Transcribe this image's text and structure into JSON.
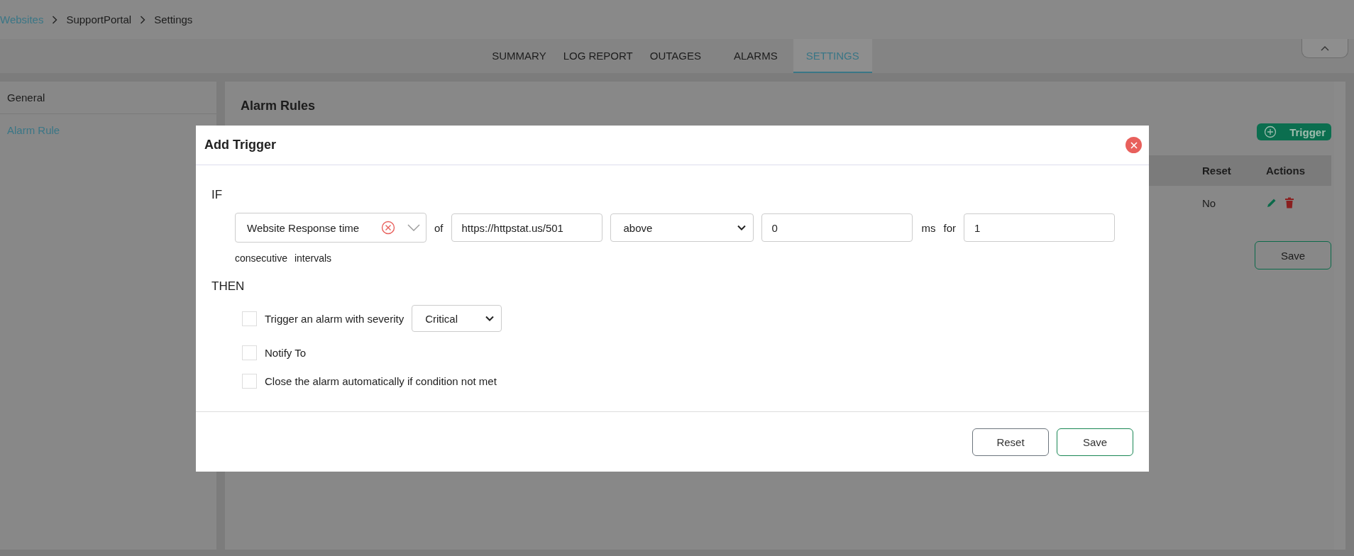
{
  "breadcrumb": [
    {
      "label": "Websites",
      "link": true
    },
    {
      "label": "SupportPortal",
      "link": false
    },
    {
      "label": "Settings",
      "link": false
    }
  ],
  "tabs": [
    {
      "label": "SUMMARY",
      "selected": false
    },
    {
      "label": "LOG REPORT",
      "selected": false
    },
    {
      "label": "OUTAGES",
      "selected": false
    },
    {
      "label": "ALARMS",
      "selected": false
    },
    {
      "label": "SETTINGS",
      "selected": true
    }
  ],
  "sidebar": {
    "items": [
      {
        "label": "General",
        "selected": false
      },
      {
        "label": "Alarm Rule",
        "selected": true
      }
    ]
  },
  "panel": {
    "title": "Alarm Rules",
    "add_button": "Trigger",
    "table": {
      "columns": [
        "Reset",
        "Actions"
      ],
      "rows": [
        {
          "reset": "No"
        }
      ]
    },
    "save_button": "Save"
  },
  "dialog": {
    "title": "Add Trigger",
    "if_label": "IF",
    "metric": "Website Response time",
    "of_label": "of",
    "url": "https://httpstat.us/501",
    "comparison": "above",
    "threshold": "0",
    "unit": "ms",
    "for_label": "for",
    "count": "1",
    "suffix": [
      "consecutive",
      "intervals"
    ],
    "then_label": "THEN",
    "actions": [
      {
        "label": "Trigger an alarm with severity",
        "checked": false,
        "severity": "Critical"
      },
      {
        "label": "Notify To",
        "checked": false
      },
      {
        "label": "Close the alarm automatically if condition not met",
        "checked": false
      }
    ],
    "buttons": [
      {
        "label": "Reset",
        "kind": "secondary"
      },
      {
        "label": "Save",
        "kind": "primary"
      }
    ]
  }
}
